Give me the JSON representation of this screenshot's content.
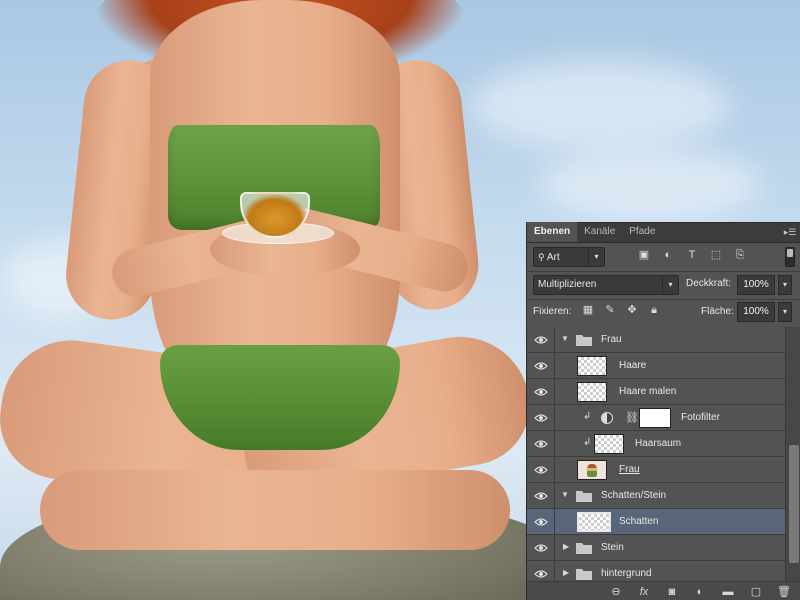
{
  "panel": {
    "tabs": [
      {
        "label": "Ebenen"
      },
      {
        "label": "Kanäle"
      },
      {
        "label": "Pfade"
      }
    ],
    "filter": {
      "kind": "Art"
    },
    "blend_mode": "Multiplizieren",
    "opacity": {
      "label": "Deckkraft:",
      "value": "100%"
    },
    "lock": {
      "label": "Fixieren:"
    },
    "fill": {
      "label": "Fläche:",
      "value": "100%"
    },
    "layers": [
      {
        "name": "Frau",
        "type": "group",
        "expanded": true
      },
      {
        "name": "Haare",
        "type": "layer"
      },
      {
        "name": "Haare malen",
        "type": "layer"
      },
      {
        "name": "Fotofilter",
        "type": "adjustment",
        "clipped": true
      },
      {
        "name": "Haarsaum",
        "type": "layer",
        "clipped": true
      },
      {
        "name": "Frau",
        "type": "layer"
      },
      {
        "name": "Schatten/Stein",
        "type": "group",
        "expanded": true
      },
      {
        "name": "Schatten",
        "type": "layer",
        "selected": true
      },
      {
        "name": "Stein",
        "type": "group",
        "expanded": false
      },
      {
        "name": "hintergrund",
        "type": "group",
        "expanded": false
      }
    ]
  },
  "colors": {
    "panel_bg": "#535353",
    "selected_row": "#596579",
    "canvas_sky": "#c6dcef"
  }
}
